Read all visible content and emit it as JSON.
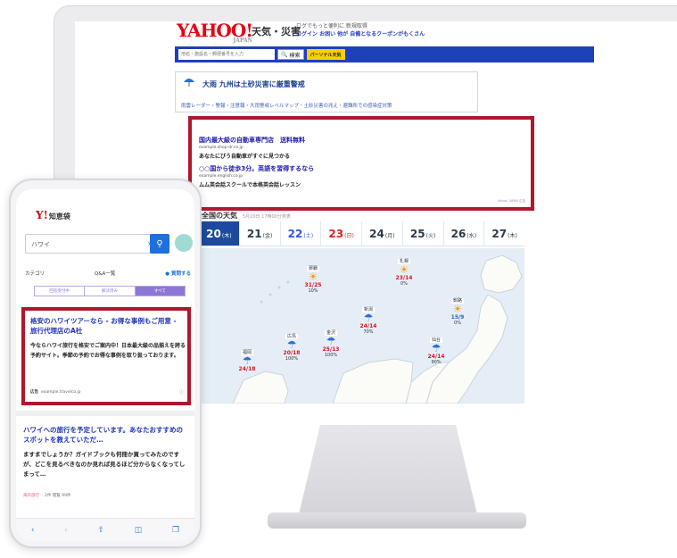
{
  "desktop": {
    "logo": "YAHOO!",
    "logo_sub": "JAPAN",
    "service": "天気・災害",
    "note_line1": "ログでもっと便利に 新規取得",
    "note_line2": "ログイン  お困い 他が 自備となるクーポンがもくさん",
    "search_placeholder": "地名・施設名・郵便番号を入力",
    "search_button": "検索",
    "partial_button": "パーソナル天気",
    "alert_title": "大雨 九州は土砂災害に厳重警戒",
    "alert_links": "雨雲レーダー・警報・注意報・大雨警戒レベルマップ・土砂災害の兆え・避難所での感染症対策",
    "ad1_title": "国内最大級の自動車専門店　送料無料",
    "ad1_url": "example.shop-dr.co.jp",
    "ad1_desc": "あなたにぴう自動車がすぐに見つかる",
    "ad2_title": "○○国から徒歩3分。英語を習得するなら",
    "ad2_url": "example.english.co.jp",
    "ad2_desc": "ムム英会話スクールで本格英会話レッスン",
    "ad_footnote": "Yahoo! JAPAN 広告",
    "weather_title": "全国の天気",
    "weather_sub": "5月20日 17時00分発表",
    "date_tabs": [
      {
        "day": "20",
        "dow": "(木)"
      },
      {
        "day": "21",
        "dow": "(金)"
      },
      {
        "day": "22",
        "dow": "(土)"
      },
      {
        "day": "23",
        "dow": "(日)"
      },
      {
        "day": "24",
        "dow": "(月)"
      },
      {
        "day": "25",
        "dow": "(火)"
      },
      {
        "day": "26",
        "dow": "(水)"
      },
      {
        "day": "27",
        "dow": "(木)"
      }
    ],
    "cities": [
      {
        "name": "那覇",
        "temp": "31/25",
        "pop": "10%"
      },
      {
        "name": "札幌",
        "temp": "23/14",
        "pop": "0%"
      },
      {
        "name": "新潟",
        "temp": "24/14",
        "pop": "70%"
      },
      {
        "name": "釧路",
        "temp": "15/9",
        "pop": "0%"
      },
      {
        "name": "広島",
        "temp": "20/18",
        "pop": "100%"
      },
      {
        "name": "金沢",
        "temp": "25/13",
        "pop": "100%"
      },
      {
        "name": "仙台",
        "temp": "24/14",
        "pop": "90%"
      },
      {
        "name": "福岡",
        "temp": "24/18",
        "pop": ""
      }
    ]
  },
  "mobile": {
    "logo": "Y!",
    "logo_text": "知恵袋",
    "search_value": "ハワイ",
    "nav": [
      "カテゴリ",
      "Q&A一覧",
      "質問する"
    ],
    "filters": [
      "回答受付中",
      "解決済み",
      "すべて"
    ],
    "ad_title": "格安のハワイツアーなら - お得な事例もご用意 - 旅行代理店のA社",
    "ad_desc": "今ならハワイ旅行を格安でご案内中！日本最大級の品揃えを誇る予約サイト。季節の予約でお得な事例を取り扱っております。",
    "ad_label": "広告",
    "ad_url": "example.travelco.jp",
    "q_title": "ハワイへの旅行を予定しています。あなたおすすめのスポットを教えていただ…",
    "q_body": "ますまでしょうか？ガイドブックも何冊か買ってみたのですが、どこを見るべきなのか見れば見るほど分からなくなってしまって…",
    "q_category": "海外旅行",
    "q_meta": "2件 閲覧 99件"
  },
  "colors": {
    "ad_border": "#b0172e",
    "yahoo_red": "#e60012",
    "nav_blue": "#1e40b8",
    "active_tab": "#1d4a9e"
  }
}
